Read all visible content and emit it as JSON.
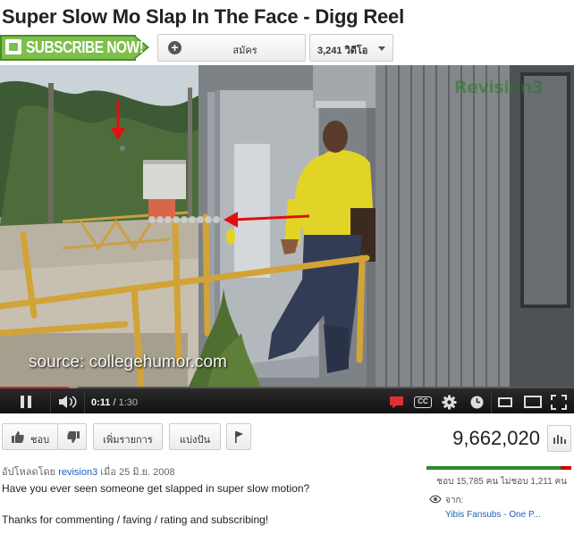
{
  "video": {
    "title": "Super Slow Mo Slap In The Face - Digg Reel",
    "watermark": "source: collegehumor.com",
    "corner_logo": "Revision3"
  },
  "subscribe": {
    "promo_label": "SUBSCRIBE NOW!",
    "button_label": "สมัคร",
    "count_label": "3,241 วิดีโอ"
  },
  "player": {
    "current_time": "0:11",
    "separator": " / ",
    "duration": "1:30",
    "progress_fraction": 0.12,
    "buffered_fraction": 0.135
  },
  "actions": {
    "like_label": "ชอบ",
    "add_to_label": "เพิ่มรายการ",
    "share_label": "แบ่งปัน"
  },
  "stats": {
    "view_count": "9,662,020",
    "likes_summary": "ชอบ 15,785 คน ไม่ชอบ 1,211 คน",
    "like_fraction": 0.929,
    "from_label": "จาก:",
    "from_source": "Yibis Fansubs - One P..."
  },
  "upload": {
    "prefix": "อัปโหลดโดย ",
    "user": "revision3",
    "date_text": " เมื่อ 25 มิ.ย. 2008"
  },
  "description": {
    "line1": "Have you ever seen someone get slapped in super slow motion?",
    "line2": "Thanks for commenting / faving / rating and subscribing!"
  },
  "colors": {
    "promo_green": "#7cc04b",
    "progress_red": "#c4302b",
    "annotation_red": "#e01010",
    "link_blue": "#1c62b9"
  }
}
